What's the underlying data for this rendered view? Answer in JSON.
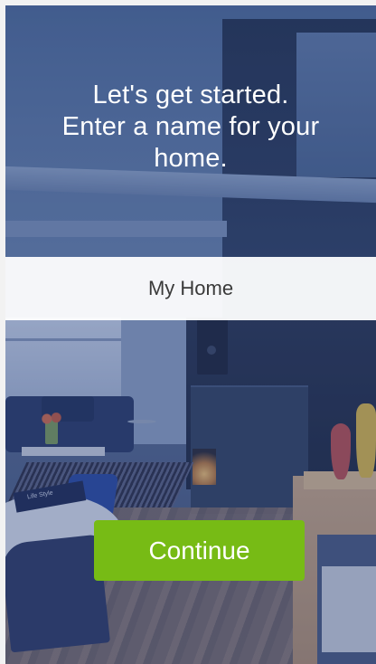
{
  "onboarding": {
    "headline": "Let's get started.\nEnter a name for your home.",
    "headline_line1": "Let's get started.",
    "headline_line2": "Enter a name for your",
    "headline_line3": "home.",
    "name_input": {
      "value": "My Home",
      "placeholder": ""
    },
    "continue_label": "Continue"
  },
  "background": {
    "book_label": "Life Style"
  },
  "colors": {
    "accent_green": "#77bb15",
    "overlay_blue": "#233c78",
    "text_white": "#ffffff",
    "input_text": "#3a3a3a"
  }
}
